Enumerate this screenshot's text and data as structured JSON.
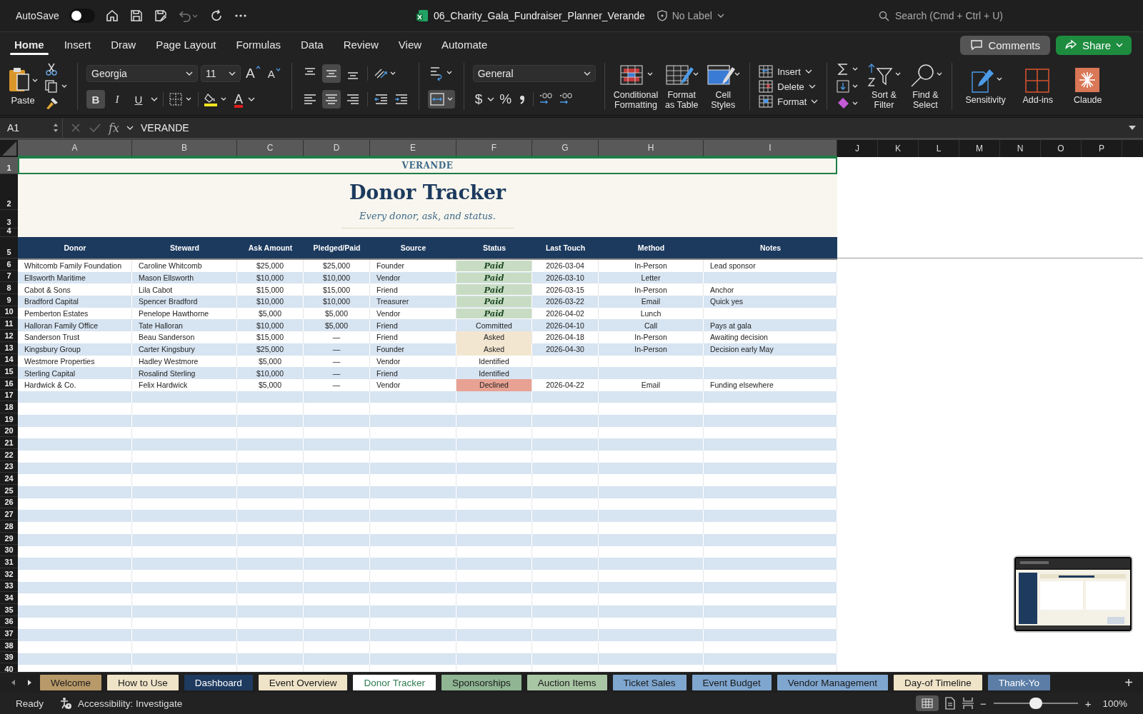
{
  "title_bar": {
    "autosave": {
      "label": "AutoSave",
      "on": false
    },
    "file_name": "06_Charity_Gala_Fundraiser_Planner_Verande",
    "sensitivity": "No Label",
    "search_placeholder": "Search (Cmd + Ctrl + U)"
  },
  "ribbon_tabs": [
    {
      "label": "Home",
      "selected": true
    },
    {
      "label": "Insert",
      "selected": false
    },
    {
      "label": "Draw",
      "selected": false
    },
    {
      "label": "Page Layout",
      "selected": false
    },
    {
      "label": "Formulas",
      "selected": false
    },
    {
      "label": "Data",
      "selected": false
    },
    {
      "label": "Review",
      "selected": false
    },
    {
      "label": "View",
      "selected": false
    },
    {
      "label": "Automate",
      "selected": false
    }
  ],
  "comments_button": "Comments",
  "share_button": "Share",
  "ribbon": {
    "paste_label": "Paste",
    "font_name": "Georgia",
    "font_size": "11",
    "grow_font": "A",
    "shrink_font": "A",
    "style_buttons": [
      {
        "label": "B",
        "selected": true
      },
      {
        "label": "I",
        "selected": false
      },
      {
        "label": "U",
        "selected": false
      }
    ],
    "font_color_glyph": "A",
    "align_vertical": [
      {
        "kind": "top",
        "selected": false
      },
      {
        "kind": "middle",
        "selected": true
      },
      {
        "kind": "bottom",
        "selected": false
      }
    ],
    "align_horizontal": [
      {
        "kind": "left",
        "selected": false
      },
      {
        "kind": "center",
        "selected": true
      },
      {
        "kind": "right",
        "selected": false
      }
    ],
    "merge_selected": true,
    "number_format": "General",
    "currency_glyph": "$",
    "percent_glyph": "%",
    "style_group": [
      {
        "kind": "conditional",
        "label_lines": [
          "Conditional",
          "Formatting"
        ]
      },
      {
        "kind": "table",
        "label_lines": [
          "Format",
          "as Table"
        ]
      },
      {
        "kind": "cellstyles",
        "label_lines": [
          "Cell",
          "Styles"
        ]
      }
    ],
    "cells_group": [
      {
        "kind": "insert",
        "label": "Insert"
      },
      {
        "kind": "delete",
        "label": "Delete"
      },
      {
        "kind": "format",
        "label": "Format"
      }
    ],
    "edit_group": [
      {
        "kind": "sort",
        "label_lines": [
          "Sort &",
          "Filter"
        ]
      },
      {
        "kind": "find",
        "label_lines": [
          "Find &",
          "Select"
        ]
      }
    ],
    "extra_group": [
      {
        "kind": "sensitivity",
        "label": "Sensitivity"
      },
      {
        "kind": "addins",
        "label": "Add-ins"
      },
      {
        "kind": "claude",
        "label": "Claude"
      }
    ]
  },
  "formula_bar": {
    "name_box": "A1",
    "fx": "fx",
    "formula": "VERANDE"
  },
  "sheet": {
    "column_letters": [
      {
        "label": "A",
        "selected": true
      },
      {
        "label": "B",
        "selected": true
      },
      {
        "label": "C",
        "selected": true
      },
      {
        "label": "D",
        "selected": true
      },
      {
        "label": "E",
        "selected": true
      },
      {
        "label": "F",
        "selected": true
      },
      {
        "label": "G",
        "selected": true
      },
      {
        "label": "H",
        "selected": true
      },
      {
        "label": "I",
        "selected": true
      },
      {
        "label": "J",
        "selected": false
      },
      {
        "label": "K",
        "selected": false
      },
      {
        "label": "L",
        "selected": false
      },
      {
        "label": "M",
        "selected": false
      },
      {
        "label": "N",
        "selected": false
      },
      {
        "label": "O",
        "selected": false
      },
      {
        "label": "P",
        "selected": false
      }
    ],
    "row_numbers": [
      {
        "label": "1",
        "selected": true
      },
      {
        "label": "2",
        "selected": false
      },
      {
        "label": "3",
        "selected": false
      },
      {
        "label": "4",
        "selected": false
      },
      {
        "label": "5",
        "selected": false
      },
      {
        "label": "6",
        "selected": false
      },
      {
        "label": "7",
        "selected": false
      },
      {
        "label": "8",
        "selected": false
      },
      {
        "label": "9",
        "selected": false
      },
      {
        "label": "10",
        "selected": false
      },
      {
        "label": "11",
        "selected": false
      },
      {
        "label": "12",
        "selected": false
      },
      {
        "label": "13",
        "selected": false
      },
      {
        "label": "14",
        "selected": false
      },
      {
        "label": "15",
        "selected": false
      },
      {
        "label": "16",
        "selected": false
      },
      {
        "label": "17",
        "selected": false
      },
      {
        "label": "18",
        "selected": false
      },
      {
        "label": "19",
        "selected": false
      },
      {
        "label": "20",
        "selected": false
      },
      {
        "label": "21",
        "selected": false
      },
      {
        "label": "22",
        "selected": false
      },
      {
        "label": "23",
        "selected": false
      },
      {
        "label": "24",
        "selected": false
      },
      {
        "label": "25",
        "selected": false
      },
      {
        "label": "26",
        "selected": false
      },
      {
        "label": "27",
        "selected": false
      },
      {
        "label": "28",
        "selected": false
      },
      {
        "label": "29",
        "selected": false
      },
      {
        "label": "30",
        "selected": false
      },
      {
        "label": "31",
        "selected": false
      },
      {
        "label": "32",
        "selected": false
      },
      {
        "label": "33",
        "selected": false
      },
      {
        "label": "34",
        "selected": false
      },
      {
        "label": "35",
        "selected": false
      },
      {
        "label": "36",
        "selected": false
      },
      {
        "label": "37",
        "selected": false
      },
      {
        "label": "38",
        "selected": false
      },
      {
        "label": "39",
        "selected": false
      },
      {
        "label": "40",
        "selected": false
      }
    ],
    "brand": "VERANDE",
    "title": "Donor Tracker",
    "subtitle": "Every donor, ask, and status.",
    "headers": [
      "Donor",
      "Steward",
      "Ask Amount",
      "Pledged/Paid",
      "Source",
      "Status",
      "Last Touch",
      "Method",
      "Notes"
    ],
    "rows": [
      {
        "donor": "Whitcomb Family Foundation",
        "steward": "Caroline Whitcomb",
        "ask_amount": "$25,000",
        "pledged_paid": "$25,000",
        "source": "Founder",
        "status": {
          "text": "Paid",
          "kind": "paid"
        },
        "last_touch": "2026-03-04",
        "method": "In-Person",
        "notes": "Lead sponsor"
      },
      {
        "donor": "Ellsworth Maritime",
        "steward": "Mason Ellsworth",
        "ask_amount": "$10,000",
        "pledged_paid": "$10,000",
        "source": "Vendor",
        "status": {
          "text": "Paid",
          "kind": "paid"
        },
        "last_touch": "2026-03-10",
        "method": "Letter"
      },
      {
        "donor": "Cabot & Sons",
        "steward": "Lila Cabot",
        "ask_amount": "$15,000",
        "pledged_paid": "$15,000",
        "source": "Friend",
        "status": {
          "text": "Paid",
          "kind": "paid"
        },
        "last_touch": "2026-03-15",
        "method": "In-Person",
        "notes": "Anchor"
      },
      {
        "donor": "Bradford Capital",
        "steward": "Spencer Bradford",
        "ask_amount": "$10,000",
        "pledged_paid": "$10,000",
        "source": "Treasurer",
        "status": {
          "text": "Paid",
          "kind": "paid"
        },
        "last_touch": "2026-03-22",
        "method": "Email",
        "notes": "Quick yes"
      },
      {
        "donor": "Pemberton Estates",
        "steward": "Penelope Hawthorne",
        "ask_amount": "$5,000",
        "pledged_paid": "$5,000",
        "source": "Vendor",
        "status": {
          "text": "Paid",
          "kind": "paid"
        },
        "last_touch": "2026-04-02",
        "method": "Lunch"
      },
      {
        "donor": "Halloran Family Office",
        "steward": "Tate Halloran",
        "ask_amount": "$10,000",
        "pledged_paid": "$5,000",
        "source": "Friend",
        "status": {
          "text": "Committed",
          "kind": "committed"
        },
        "last_touch": "2026-04-10",
        "method": "Call",
        "notes": "Pays at gala"
      },
      {
        "donor": "Sanderson Trust",
        "steward": "Beau Sanderson",
        "ask_amount": "$15,000",
        "pledged_paid": "—",
        "source": "Friend",
        "status": {
          "text": "Asked",
          "kind": "asked"
        },
        "last_touch": "2026-04-18",
        "method": "In-Person",
        "notes": "Awaiting decision"
      },
      {
        "donor": "Kingsbury Group",
        "steward": "Carter Kingsbury",
        "ask_amount": "$25,000",
        "pledged_paid": "—",
        "source": "Founder",
        "status": {
          "text": "Asked",
          "kind": "asked"
        },
        "last_touch": "2026-04-30",
        "method": "In-Person",
        "notes": "Decision early May"
      },
      {
        "donor": "Westmore Properties",
        "steward": "Hadley Westmore",
        "ask_amount": "$5,000",
        "pledged_paid": "—",
        "source": "Vendor",
        "status": {
          "text": "Identified",
          "kind": "identified"
        }
      },
      {
        "donor": "Sterling Capital",
        "steward": "Rosalind Sterling",
        "ask_amount": "$10,000",
        "pledged_paid": "—",
        "source": "Friend",
        "status": {
          "text": "Identified",
          "kind": "identified"
        }
      },
      {
        "donor": "Hardwick & Co.",
        "steward": "Felix Hardwick",
        "ask_amount": "$5,000",
        "pledged_paid": "—",
        "source": "Vendor",
        "status": {
          "text": "Declined",
          "kind": "declined"
        },
        "last_touch": "2026-04-22",
        "method": "Email",
        "notes": "Funding elsewhere"
      }
    ]
  },
  "sheet_tabs": [
    {
      "label": "Welcome",
      "color": "#b89a6a",
      "selected": false
    },
    {
      "label": "How to Use",
      "color": "#efe3c8",
      "selected": false
    },
    {
      "label": "Dashboard",
      "color": "#1e3a5f",
      "selected": false
    },
    {
      "label": "Event Overview",
      "color": "#efe3c8",
      "selected": false
    },
    {
      "label": "Donor Tracker",
      "color": "#2e7d4f",
      "selected": true
    },
    {
      "label": "Sponsorships",
      "color": "#8fb593",
      "selected": false
    },
    {
      "label": "Auction Items",
      "color": "#a9c6a4",
      "selected": false
    },
    {
      "label": "Ticket Sales",
      "color": "#7fa6cf",
      "selected": false
    },
    {
      "label": "Event Budget",
      "color": "#7fa6cf",
      "selected": false
    },
    {
      "label": "Vendor Management",
      "color": "#7fa6cf",
      "selected": false
    },
    {
      "label": "Day-of Timeline",
      "color": "#efe3c8",
      "selected": false
    },
    {
      "label": "Thank-Yo",
      "color": "#5b7da6",
      "selected": false
    }
  ],
  "add_sheet": "+",
  "status_bar": {
    "ready": "Ready",
    "accessibility": "Accessibility: Investigate",
    "zoom_minus": "−",
    "zoom_plus": "+",
    "zoom": {
      "level": 0.5
    },
    "zoom_text": "100%"
  }
}
